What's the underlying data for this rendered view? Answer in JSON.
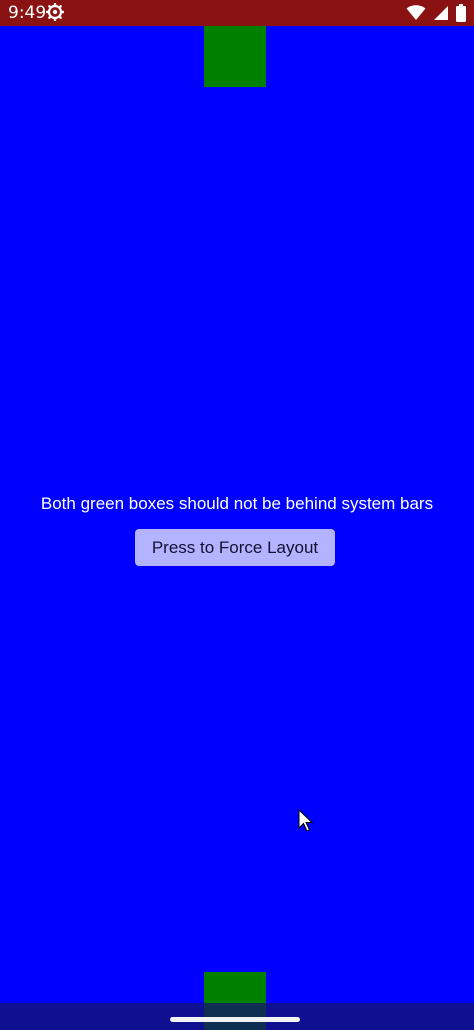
{
  "status_bar": {
    "time": "9:49",
    "icons": [
      "settings-icon",
      "wifi-icon",
      "signal-icon",
      "battery-icon"
    ],
    "background": "#8b1212"
  },
  "main": {
    "background": "#0000ff",
    "message": "Both green boxes should not be behind system bars",
    "button_label": "Press to Force Layout",
    "button_color": "#b3b3ff",
    "box_color": "#008000"
  },
  "nav_bar": {
    "handle": "gesture-handle"
  }
}
